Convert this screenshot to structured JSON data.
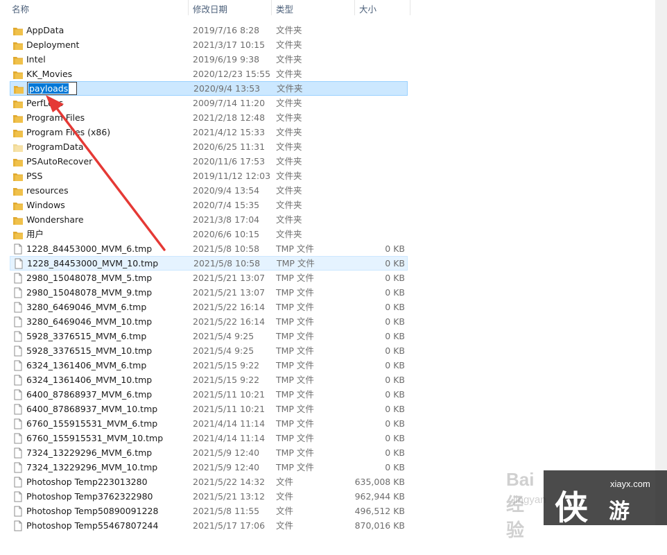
{
  "columns": {
    "name": "名称",
    "date": "修改日期",
    "type": "类型",
    "size": "大小"
  },
  "rename_value": "payloads",
  "rows": [
    {
      "name": "AppData",
      "date": "2019/7/16 8:28",
      "type": "文件夹",
      "size": "",
      "icon": "folder-icon"
    },
    {
      "name": "Deployment",
      "date": "2021/3/17 10:15",
      "type": "文件夹",
      "size": "",
      "icon": "folder-icon"
    },
    {
      "name": "Intel",
      "date": "2019/6/19 9:38",
      "type": "文件夹",
      "size": "",
      "icon": "folder-icon"
    },
    {
      "name": "KK_Movies",
      "date": "2020/12/23 15:55",
      "type": "文件夹",
      "size": "",
      "icon": "folder-icon"
    },
    {
      "name": "payloads",
      "date": "2020/9/4 13:53",
      "type": "文件夹",
      "size": "",
      "icon": "folder-icon",
      "state": "renaming"
    },
    {
      "name": "PerfLogs",
      "date": "2009/7/14 11:20",
      "type": "文件夹",
      "size": "",
      "icon": "folder-icon"
    },
    {
      "name": "Program Files",
      "date": "2021/2/18 12:48",
      "type": "文件夹",
      "size": "",
      "icon": "folder-icon"
    },
    {
      "name": "Program Files (x86)",
      "date": "2021/4/12 15:33",
      "type": "文件夹",
      "size": "",
      "icon": "folder-icon"
    },
    {
      "name": "ProgramData",
      "date": "2020/6/25 11:31",
      "type": "文件夹",
      "size": "",
      "icon": "folder-hidden-icon"
    },
    {
      "name": "PSAutoRecover",
      "date": "2020/11/6 17:53",
      "type": "文件夹",
      "size": "",
      "icon": "folder-icon"
    },
    {
      "name": "PSS",
      "date": "2019/11/12 12:03",
      "type": "文件夹",
      "size": "",
      "icon": "folder-icon"
    },
    {
      "name": "resources",
      "date": "2020/9/4 13:54",
      "type": "文件夹",
      "size": "",
      "icon": "folder-icon"
    },
    {
      "name": "Windows",
      "date": "2020/7/4 15:35",
      "type": "文件夹",
      "size": "",
      "icon": "folder-icon"
    },
    {
      "name": "Wondershare",
      "date": "2021/3/8 17:04",
      "type": "文件夹",
      "size": "",
      "icon": "folder-icon"
    },
    {
      "name": "用户",
      "date": "2020/6/6 10:15",
      "type": "文件夹",
      "size": "",
      "icon": "folder-icon"
    },
    {
      "name": "1228_84453000_MVM_6.tmp",
      "date": "2021/5/8 10:58",
      "type": "TMP 文件",
      "size": "0 KB",
      "icon": "file-icon"
    },
    {
      "name": "1228_84453000_MVM_10.tmp",
      "date": "2021/5/8 10:58",
      "type": "TMP 文件",
      "size": "0 KB",
      "icon": "file-icon",
      "state": "hover"
    },
    {
      "name": "2980_15048078_MVM_5.tmp",
      "date": "2021/5/21 13:07",
      "type": "TMP 文件",
      "size": "0 KB",
      "icon": "file-icon"
    },
    {
      "name": "2980_15048078_MVM_9.tmp",
      "date": "2021/5/21 13:07",
      "type": "TMP 文件",
      "size": "0 KB",
      "icon": "file-icon"
    },
    {
      "name": "3280_6469046_MVM_6.tmp",
      "date": "2021/5/22 16:14",
      "type": "TMP 文件",
      "size": "0 KB",
      "icon": "file-icon"
    },
    {
      "name": "3280_6469046_MVM_10.tmp",
      "date": "2021/5/22 16:14",
      "type": "TMP 文件",
      "size": "0 KB",
      "icon": "file-icon"
    },
    {
      "name": "5928_3376515_MVM_6.tmp",
      "date": "2021/5/4 9:25",
      "type": "TMP 文件",
      "size": "0 KB",
      "icon": "file-icon"
    },
    {
      "name": "5928_3376515_MVM_10.tmp",
      "date": "2021/5/4 9:25",
      "type": "TMP 文件",
      "size": "0 KB",
      "icon": "file-icon"
    },
    {
      "name": "6324_1361406_MVM_6.tmp",
      "date": "2021/5/15 9:22",
      "type": "TMP 文件",
      "size": "0 KB",
      "icon": "file-icon"
    },
    {
      "name": "6324_1361406_MVM_10.tmp",
      "date": "2021/5/15 9:22",
      "type": "TMP 文件",
      "size": "0 KB",
      "icon": "file-icon"
    },
    {
      "name": "6400_87868937_MVM_6.tmp",
      "date": "2021/5/11 10:21",
      "type": "TMP 文件",
      "size": "0 KB",
      "icon": "file-icon"
    },
    {
      "name": "6400_87868937_MVM_10.tmp",
      "date": "2021/5/11 10:21",
      "type": "TMP 文件",
      "size": "0 KB",
      "icon": "file-icon"
    },
    {
      "name": "6760_155915531_MVM_6.tmp",
      "date": "2021/4/14 11:14",
      "type": "TMP 文件",
      "size": "0 KB",
      "icon": "file-icon"
    },
    {
      "name": "6760_155915531_MVM_10.tmp",
      "date": "2021/4/14 11:14",
      "type": "TMP 文件",
      "size": "0 KB",
      "icon": "file-icon"
    },
    {
      "name": "7324_13229296_MVM_6.tmp",
      "date": "2021/5/9 12:40",
      "type": "TMP 文件",
      "size": "0 KB",
      "icon": "file-icon"
    },
    {
      "name": "7324_13229296_MVM_10.tmp",
      "date": "2021/5/9 12:40",
      "type": "TMP 文件",
      "size": "0 KB",
      "icon": "file-icon"
    },
    {
      "name": "Photoshop Temp223013280",
      "date": "2021/5/22 14:32",
      "type": "文件",
      "size": "635,008 KB",
      "icon": "file-icon"
    },
    {
      "name": "Photoshop Temp3762322980",
      "date": "2021/5/21 13:12",
      "type": "文件",
      "size": "962,944 KB",
      "icon": "file-icon"
    },
    {
      "name": "Photoshop Temp50890091228",
      "date": "2021/5/8 11:55",
      "type": "文件",
      "size": "496,512 KB",
      "icon": "file-icon"
    },
    {
      "name": "Photoshop Temp55467807244",
      "date": "2021/5/17 17:06",
      "type": "文件",
      "size": "870,016 KB",
      "icon": "file-icon"
    }
  ],
  "watermark": {
    "baidu": "Bai 经验",
    "jingyan": "jingyan",
    "site": "xiayx.com",
    "char": "侠",
    "game": "游戏"
  },
  "colors": {
    "selection": "#cce8ff",
    "selection_border": "#99d1ff",
    "hover": "#e5f3ff",
    "arrow": "#e53935",
    "folder": "#f0c14b"
  }
}
